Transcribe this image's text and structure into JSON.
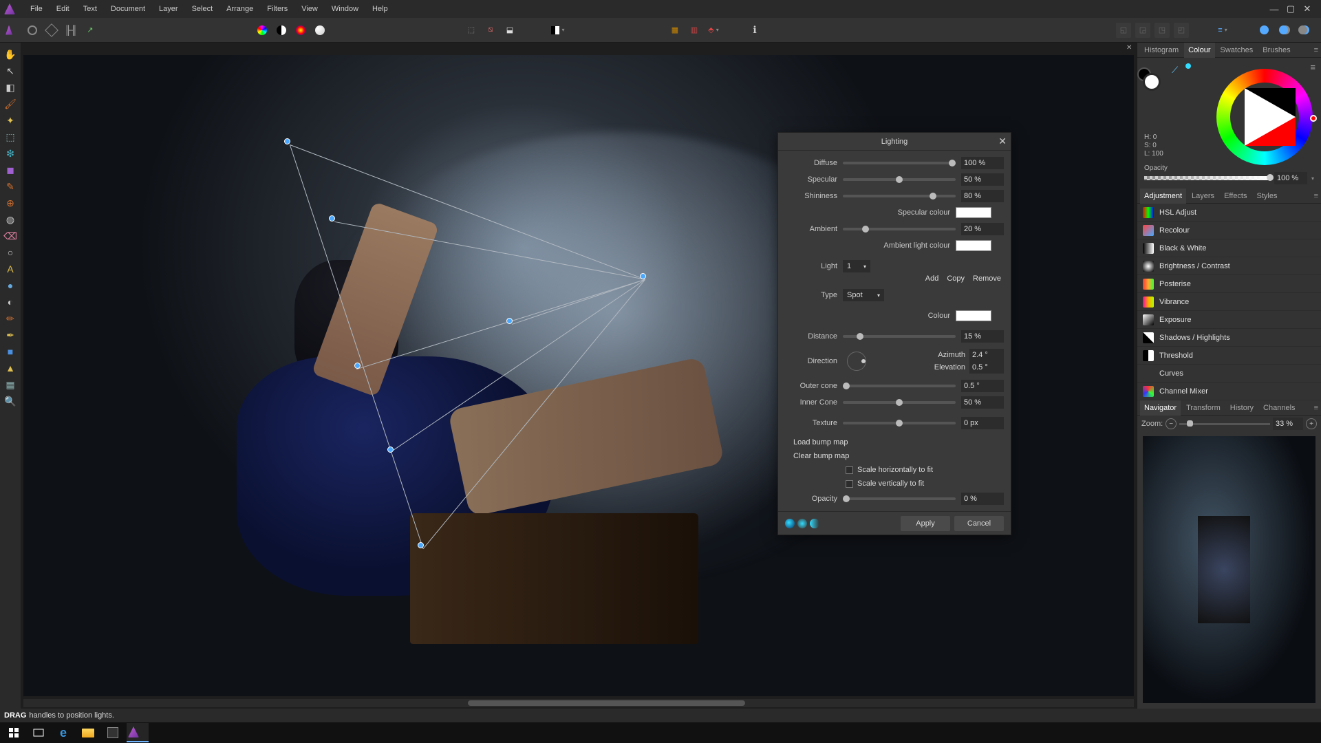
{
  "menu": [
    "File",
    "Edit",
    "Text",
    "Document",
    "Layer",
    "Select",
    "Arrange",
    "Filters",
    "View",
    "Window",
    "Help"
  ],
  "tools": [
    {
      "name": "hand-tool",
      "glyph": "✋",
      "color": "#e0b060"
    },
    {
      "name": "move-tool",
      "glyph": "↖",
      "color": "#ccc"
    },
    {
      "name": "crop-tool",
      "glyph": "◧",
      "color": "#ccc"
    },
    {
      "name": "brush-tool",
      "glyph": "🖌",
      "color": "#d07030"
    },
    {
      "name": "clone-tool",
      "glyph": "✦",
      "color": "#e0c050"
    },
    {
      "name": "marquee-tool",
      "glyph": "⬚",
      "color": "#8aa"
    },
    {
      "name": "flood-select-tool",
      "glyph": "❇",
      "color": "#4ab"
    },
    {
      "name": "gradient-tool",
      "glyph": "◼",
      "color": "#a060d0"
    },
    {
      "name": "pen-tool",
      "glyph": "✎",
      "color": "#d07030"
    },
    {
      "name": "heal-tool",
      "glyph": "⊕",
      "color": "#d07030"
    },
    {
      "name": "patch-tool",
      "glyph": "◍",
      "color": "#ccc"
    },
    {
      "name": "eraser-tool",
      "glyph": "⌫",
      "color": "#e8a"
    },
    {
      "name": "dodge-tool",
      "glyph": "○",
      "color": "#ccc"
    },
    {
      "name": "text-tool",
      "glyph": "A",
      "color": "#e0c050"
    },
    {
      "name": "blur-tool",
      "glyph": "●",
      "color": "#6ad"
    },
    {
      "name": "sponge-tool",
      "glyph": "◐",
      "color": "#ccc"
    },
    {
      "name": "pencil-tool",
      "glyph": "✏",
      "color": "#d07030"
    },
    {
      "name": "paint-tool",
      "glyph": "✒",
      "color": "#e0c050"
    },
    {
      "name": "shape-tool",
      "glyph": "■",
      "color": "#4a90e2"
    },
    {
      "name": "vector-tool",
      "glyph": "▲",
      "color": "#e0c050"
    },
    {
      "name": "mesh-tool",
      "glyph": "▦",
      "color": "#8aa"
    },
    {
      "name": "zoom-tool",
      "glyph": "🔍",
      "color": "#4a90e2"
    }
  ],
  "panelTabs1": [
    "Histogram",
    "Colour",
    "Swatches",
    "Brushes"
  ],
  "panelTabs1Active": 1,
  "hsl": {
    "h": "H: 0",
    "s": "S: 0",
    "l": "L: 100"
  },
  "opacityLabel": "Opacity",
  "opacityValue": "100 %",
  "panelTabs2": [
    "Adjustment",
    "Layers",
    "Effects",
    "Styles"
  ],
  "panelTabs2Active": 0,
  "adjustments": [
    {
      "label": "HSL Adjust",
      "bg": "linear-gradient(90deg,#f00,#0f0,#00f)"
    },
    {
      "label": "Recolour",
      "bg": "linear-gradient(135deg,#f44,#4af)"
    },
    {
      "label": "Black & White",
      "bg": "linear-gradient(90deg,#000,#fff)"
    },
    {
      "label": "Brightness / Contrast",
      "bg": "radial-gradient(circle,#fff,#000)"
    },
    {
      "label": "Posterise",
      "bg": "linear-gradient(90deg,#f33,#fa3,#3f3)"
    },
    {
      "label": "Vibrance",
      "bg": "linear-gradient(90deg,#f0a,#fa0,#af0)"
    },
    {
      "label": "Exposure",
      "bg": "linear-gradient(135deg,#fff,#000)"
    },
    {
      "label": "Shadows / Highlights",
      "bg": "linear-gradient(45deg,#000 50%,#fff 50%)"
    },
    {
      "label": "Threshold",
      "bg": "linear-gradient(90deg,#000 50%,#fff 50%)"
    },
    {
      "label": "Curves",
      "bg": "#333"
    },
    {
      "label": "Channel Mixer",
      "bg": "conic-gradient(#f33,#3f3,#33f,#f33)"
    }
  ],
  "panelTabs3": [
    "Navigator",
    "Transform",
    "History",
    "Channels"
  ],
  "panelTabs3Active": 0,
  "zoomLabel": "Zoom:",
  "zoomValue": "33 %",
  "status": {
    "bold": "DRAG",
    "rest": "handles to position lights."
  },
  "dialog": {
    "title": "Lighting",
    "diffuse": {
      "label": "Diffuse",
      "val": "100 %",
      "pct": 100
    },
    "specular": {
      "label": "Specular",
      "val": "50 %",
      "pct": 50
    },
    "shininess": {
      "label": "Shininess",
      "val": "80 %",
      "pct": 80
    },
    "specColour": "Specular colour",
    "ambient": {
      "label": "Ambient",
      "val": "20 %",
      "pct": 20
    },
    "ambColour": "Ambient light colour",
    "lightLabel": "Light",
    "lightSel": "1",
    "add": "Add",
    "copy": "Copy",
    "remove": "Remove",
    "typeLabel": "Type",
    "typeSel": "Spot",
    "colourLabel": "Colour",
    "distance": {
      "label": "Distance",
      "val": "15 %",
      "pct": 15
    },
    "directionLabel": "Direction",
    "azimuth": {
      "label": "Azimuth",
      "val": "2.4 °"
    },
    "elevation": {
      "label": "Elevation",
      "val": "0.5 °"
    },
    "outerCone": {
      "label": "Outer cone",
      "val": "0.5 °",
      "pct": 2
    },
    "innerCone": {
      "label": "Inner Cone",
      "val": "50 %",
      "pct": 50
    },
    "texture": {
      "label": "Texture",
      "val": "0 px",
      "pct": 50
    },
    "loadBump": "Load bump map",
    "clearBump": "Clear bump map",
    "scaleH": "Scale horizontally to fit",
    "scaleV": "Scale vertically to fit",
    "opacity": {
      "label": "Opacity",
      "val": "0 %",
      "pct": 0
    },
    "apply": "Apply",
    "cancel": "Cancel"
  }
}
